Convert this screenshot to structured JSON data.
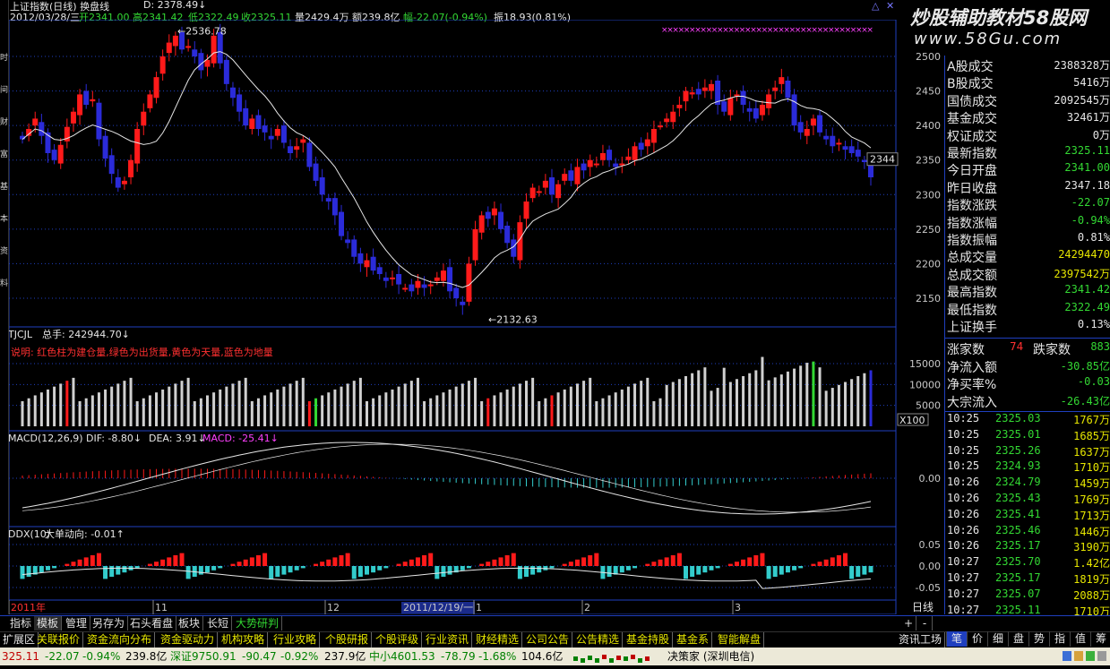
{
  "header": {
    "title": "上证指数(日线) 换盘线",
    "d_label": "D: 2378.49↓",
    "date": "2012/03/28/三",
    "open_label": "开2341.00",
    "high_label": "高2341.42",
    "low_label": "低2322.49",
    "close_label": "收2325.11",
    "vol_label": "量2429.4万",
    "amount_label": "额239.8亿",
    "change_label": "幅-22.07(-0.94%)",
    "amplitude_label": "振18.93(0.81%)",
    "watermark_1": "炒股辅助教材58股网",
    "watermark_2": "www.58Gu.com"
  },
  "left_strip_text": "时间财富基本资料",
  "main_chart": {
    "y_ticks": [
      "2500",
      "2450",
      "2400",
      "2350",
      "2300",
      "2250",
      "2200",
      "2150"
    ],
    "high_marker": "2536.78",
    "low_marker": "2132.63",
    "last_value": "2344",
    "colors": {
      "up": "#ff1a1a",
      "down": "#2b2bd9",
      "ma": "#e6e6e6",
      "axis": "#1f3fbf"
    }
  },
  "volume_panel": {
    "title": "TJCJL",
    "total_label": "总手: 242944.70↓",
    "note": "说明: 红色柱为建仓量,绿色为出货量,黄色为天量,蓝色为地量",
    "y_ticks": [
      "15000",
      "10000",
      "5000"
    ],
    "unit": "X100"
  },
  "macd_panel": {
    "title": "MACD(12,26,9)",
    "dif": "DIF: -8.80↓",
    "dea": "DEA: 3.91↓",
    "macd": "MACD: -25.41↓",
    "y_tick": "0.00"
  },
  "ddx_panel": {
    "title": "DDX(10)",
    "label": "大单动向: -0.01↑",
    "y_ticks": [
      "0.05",
      "0.00",
      "-0.05"
    ]
  },
  "time_axis": {
    "labels": [
      "2011年",
      "11",
      "12",
      "2011/12/19/一",
      "1",
      "2",
      "3"
    ],
    "period": "日线"
  },
  "sidebar": {
    "rows": [
      {
        "k": "A股成交",
        "v": "2388328万",
        "c": "#e6e6e6"
      },
      {
        "k": "B股成交",
        "v": "5416万",
        "c": "#e6e6e6"
      },
      {
        "k": "国债成交",
        "v": "2092545万",
        "c": "#e6e6e6"
      },
      {
        "k": "基金成交",
        "v": "32461万",
        "c": "#e6e6e6"
      },
      {
        "k": "权证成交",
        "v": "0万",
        "c": "#e6e6e6"
      },
      {
        "k": "最新指数",
        "v": "2325.11",
        "c": "#33d833"
      },
      {
        "k": "今日开盘",
        "v": "2341.00",
        "c": "#33d833"
      },
      {
        "k": "昨日收盘",
        "v": "2347.18",
        "c": "#e6e6e6"
      },
      {
        "k": "指数涨跌",
        "v": "-22.07",
        "c": "#33d833"
      },
      {
        "k": "指数涨幅",
        "v": "-0.94%",
        "c": "#33d833"
      },
      {
        "k": "指数振幅",
        "v": "0.81%",
        "c": "#e6e6e6"
      },
      {
        "k": "总成交量",
        "v": "24294470",
        "c": "#e6e600"
      },
      {
        "k": "总成交额",
        "v": "2397542万",
        "c": "#e6e600"
      },
      {
        "k": "最高指数",
        "v": "2341.42",
        "c": "#33d833"
      },
      {
        "k": "最低指数",
        "v": "2322.49",
        "c": "#33d833"
      },
      {
        "k": "上证换手",
        "v": "0.13%",
        "c": "#e6e6e6"
      }
    ],
    "up_label": "涨家数",
    "up_count": "74",
    "down_label": "跌家数",
    "down_count": "883",
    "flow_rows": [
      {
        "k": "净流入额",
        "v": "-30.85亿",
        "c": "#33d833"
      },
      {
        "k": "净买率%",
        "v": "-0.03",
        "c": "#33d833"
      },
      {
        "k": "大宗流入",
        "v": "-26.43亿",
        "c": "#33d833"
      }
    ],
    "ticks": [
      {
        "t": "10:25",
        "p": "2325.03",
        "q": "1767万"
      },
      {
        "t": "10:25",
        "p": "2325.01",
        "q": "1685万"
      },
      {
        "t": "10:25",
        "p": "2325.26",
        "q": "1637万"
      },
      {
        "t": "10:25",
        "p": "2324.93",
        "q": "1710万"
      },
      {
        "t": "10:26",
        "p": "2324.79",
        "q": "1459万"
      },
      {
        "t": "10:26",
        "p": "2325.43",
        "q": "1769万"
      },
      {
        "t": "10:26",
        "p": "2325.41",
        "q": "1713万"
      },
      {
        "t": "10:26",
        "p": "2325.46",
        "q": "1446万"
      },
      {
        "t": "10:26",
        "p": "2325.17",
        "q": "3190万"
      },
      {
        "t": "10:27",
        "p": "2325.70",
        "q": "1.42亿"
      },
      {
        "t": "10:27",
        "p": "2325.17",
        "q": "1819万"
      },
      {
        "t": "10:27",
        "p": "2325.07",
        "q": "2088万"
      },
      {
        "t": "10:27",
        "p": "2325.11",
        "q": "1710万"
      }
    ]
  },
  "tabs": [
    "指标",
    "模板",
    "管理",
    "另存为",
    "石头看盘",
    "板块",
    "长短",
    "大势研判"
  ],
  "tab_controls": [
    "+",
    "-"
  ],
  "menu": [
    "扩展区",
    "关联报价",
    "资金流向分布",
    "资金驱动力",
    "机构攻略",
    "行业攻略",
    "个股研报",
    "个股评级",
    "行业资讯",
    "财经精选",
    "公司公告",
    "公告精选",
    "基金持股",
    "基金系",
    "智能解盘"
  ],
  "menu_right": "资讯工场",
  "right_tabs": [
    "笔",
    "价",
    "细",
    "盘",
    "势",
    "指",
    "值",
    "筹"
  ],
  "status": {
    "sh": "325.11",
    "sh_chg": "-22.07",
    "sh_pct": "-0.94%",
    "sh_amt": "239.8亿",
    "sz_label": "深证9750.91",
    "sz_chg": "-90.47",
    "sz_pct": "-0.92%",
    "sz_amt": "237.9亿",
    "zx_label": "中小4601.53",
    "zx_chg": "-78.79",
    "zx_pct": "-1.68%",
    "zx_amt": "104.6亿",
    "brand": "决策家 (深圳电信)"
  }
}
